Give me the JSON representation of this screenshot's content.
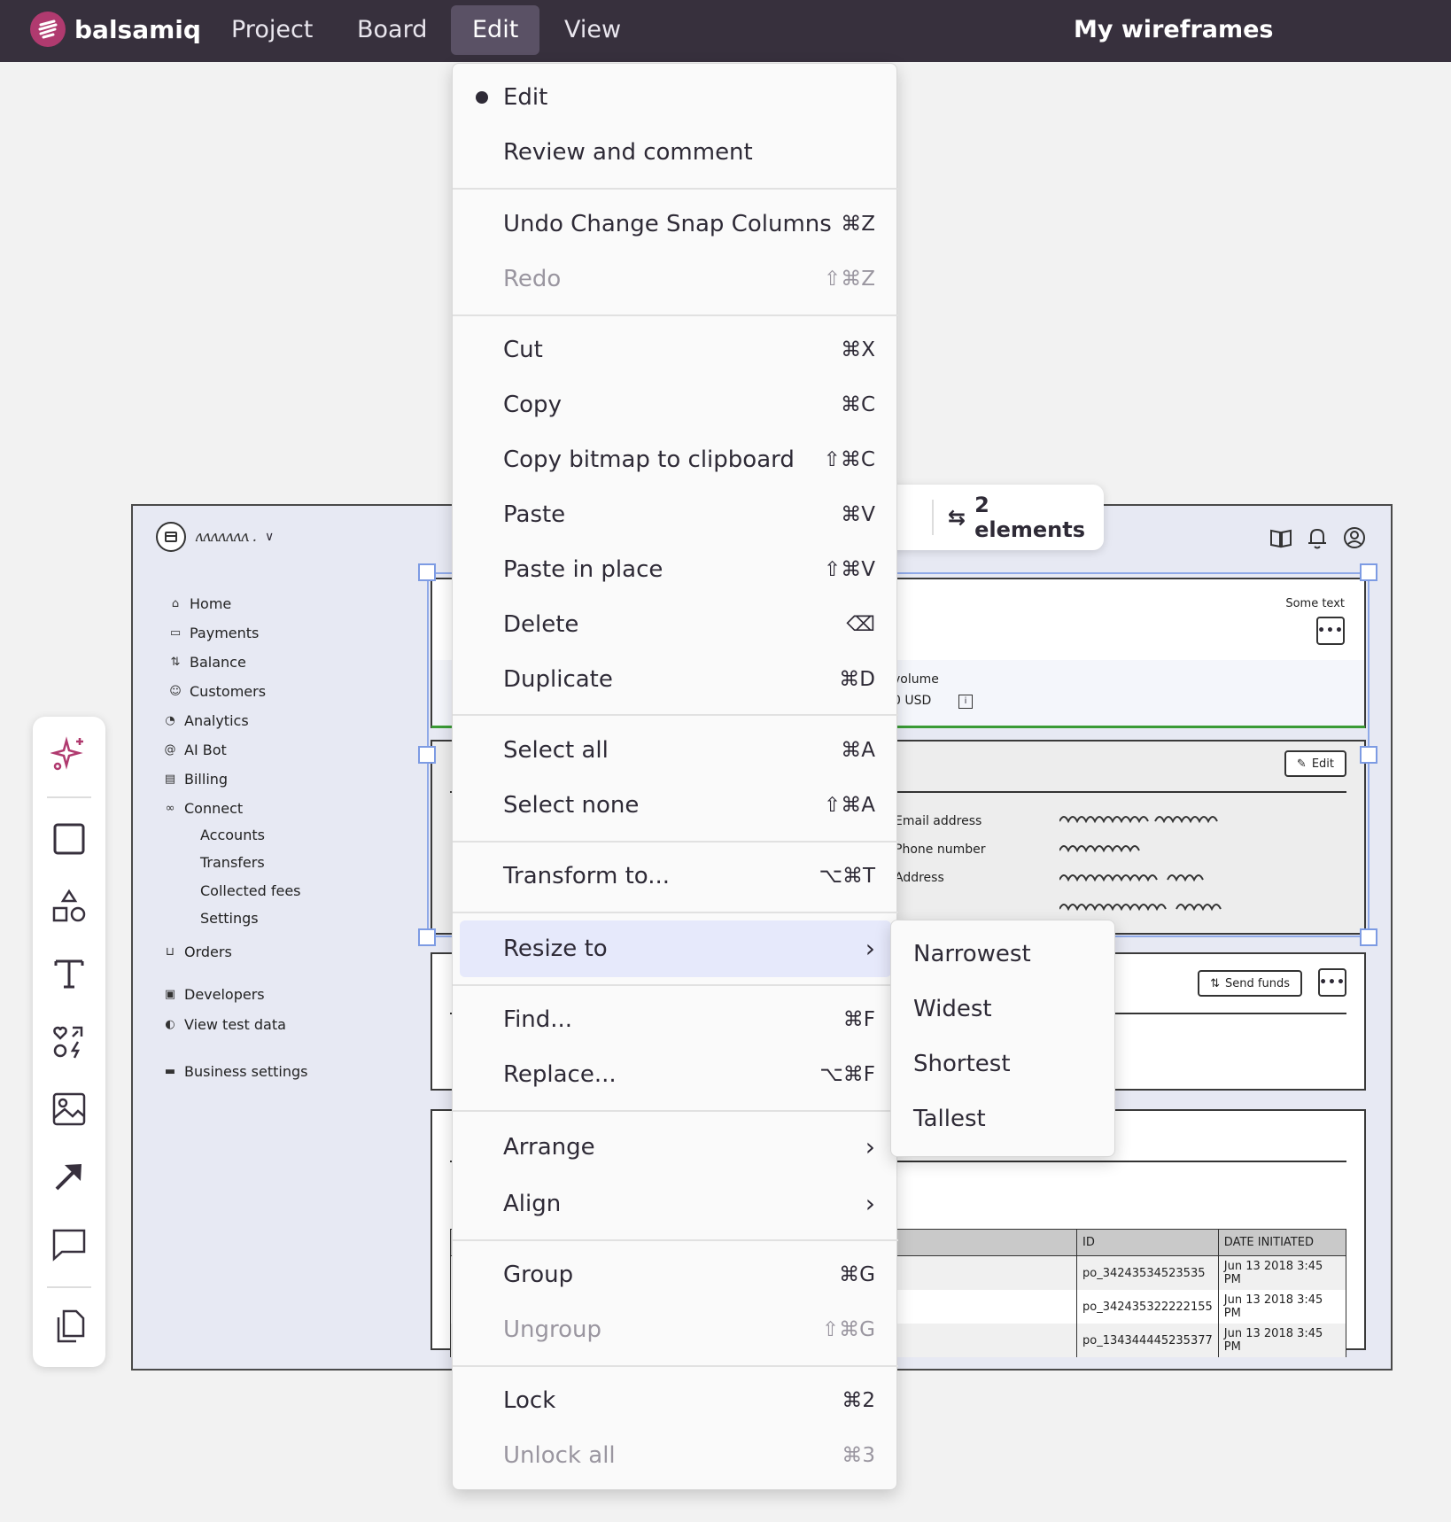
{
  "app": {
    "logo_text": "balsamiq",
    "project_title": "My wireframes"
  },
  "menubar": {
    "items": [
      "Project",
      "Board",
      "Edit",
      "View"
    ],
    "active": "Edit"
  },
  "edit_menu": {
    "mode_edit": "Edit",
    "mode_review": "Review and comment",
    "undo": {
      "label": "Undo Change Snap Columns",
      "shortcut": "⌘Z"
    },
    "redo": {
      "label": "Redo",
      "shortcut": "⇧⌘Z"
    },
    "cut": {
      "label": "Cut",
      "shortcut": "⌘X"
    },
    "copy": {
      "label": "Copy",
      "shortcut": "⌘C"
    },
    "copy_bitmap": {
      "label": "Copy bitmap to clipboard",
      "shortcut": "⇧⌘C"
    },
    "paste": {
      "label": "Paste",
      "shortcut": "⌘V"
    },
    "paste_in_place": {
      "label": "Paste in place",
      "shortcut": "⇧⌘V"
    },
    "delete": {
      "label": "Delete",
      "shortcut": "⌫"
    },
    "duplicate": {
      "label": "Duplicate",
      "shortcut": "⌘D"
    },
    "select_all": {
      "label": "Select all",
      "shortcut": "⌘A"
    },
    "select_none": {
      "label": "Select none",
      "shortcut": "⇧⌘A"
    },
    "transform": {
      "label": "Transform to...",
      "shortcut": "⌥⌘T"
    },
    "resize_to": {
      "label": "Resize to",
      "shortcut": "›"
    },
    "find": {
      "label": "Find...",
      "shortcut": "⌘F"
    },
    "replace": {
      "label": "Replace...",
      "shortcut": "⌥⌘F"
    },
    "arrange": {
      "label": "Arrange",
      "shortcut": "›"
    },
    "align": {
      "label": "Align",
      "shortcut": "›"
    },
    "group": {
      "label": "Group",
      "shortcut": "⌘G"
    },
    "ungroup": {
      "label": "Ungroup",
      "shortcut": "⇧⌘G"
    },
    "lock": {
      "label": "Lock",
      "shortcut": "⌘2"
    },
    "unlock_all": {
      "label": "Unlock all",
      "shortcut": "⌘3"
    }
  },
  "resize_submenu": [
    "Narrowest",
    "Widest",
    "Shortest",
    "Tallest"
  ],
  "selection_toolbar": {
    "label": "2 elements"
  },
  "wireframe": {
    "account_scribble": "ʌʌʌʌʌʌʌ .",
    "nav": [
      "Home",
      "Payments",
      "Balance",
      "Customers",
      "Analytics",
      "AI Bot",
      "Billing",
      "Connect"
    ],
    "connect_sub": [
      "Accounts",
      "Transfers",
      "Collected fees",
      "Settings"
    ],
    "nav2": [
      "Orders",
      "Developers",
      "View test data",
      "Business settings"
    ],
    "some_text": "Some text",
    "volume_label": "volume",
    "volume_value": "0 USD",
    "edit_button": "Edit",
    "fields": [
      "Email address",
      "Phone number",
      "Address"
    ],
    "send_funds": "Send funds",
    "table": {
      "headers": [
        "ID",
        "DATE INITIATED"
      ],
      "rows": [
        [
          "po_34243534523535",
          "Jun 13 2018 3:45 PM"
        ],
        [
          "po_342435322222155",
          "Jun 13 2018 3:45 PM"
        ],
        [
          "po_134344445235377",
          "Jun 13 2018 3:45 PM"
        ]
      ]
    }
  }
}
